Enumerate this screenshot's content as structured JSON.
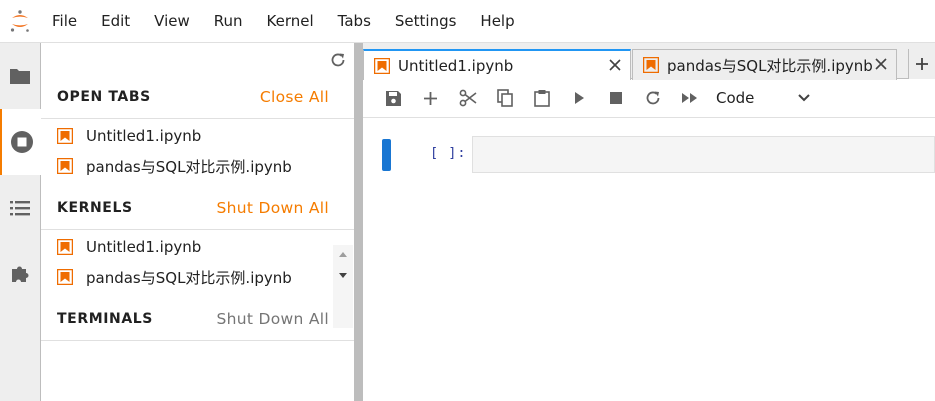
{
  "menubar": {
    "items": [
      "File",
      "Edit",
      "View",
      "Run",
      "Kernel",
      "Tabs",
      "Settings",
      "Help"
    ]
  },
  "leftbar": {
    "icons": [
      "folder-icon",
      "running-icon",
      "toc-icon",
      "extension-icon"
    ]
  },
  "sidebar": {
    "open_tabs": {
      "title": "OPEN TABS",
      "action": "Close All",
      "items": [
        "Untitled1.ipynb",
        "pandas与SQL对比示例.ipynb"
      ]
    },
    "kernels": {
      "title": "KERNELS",
      "action": "Shut Down All",
      "items": [
        "Untitled1.ipynb",
        "pandas与SQL对比示例.ipynb"
      ]
    },
    "terminals": {
      "title": "TERMINALS",
      "action": "Shut Down All"
    }
  },
  "tabs": [
    {
      "title": "Untitled1.ipynb",
      "active": true
    },
    {
      "title": "pandas与SQL对比示例.ipynb",
      "active": false
    }
  ],
  "toolbar": {
    "cell_type": "Code"
  },
  "cell": {
    "prompt": "[ ]:"
  },
  "colors": {
    "accent": "#f57c00",
    "active_tab": "#2196f3",
    "cell_collapser": "#1976d2"
  }
}
